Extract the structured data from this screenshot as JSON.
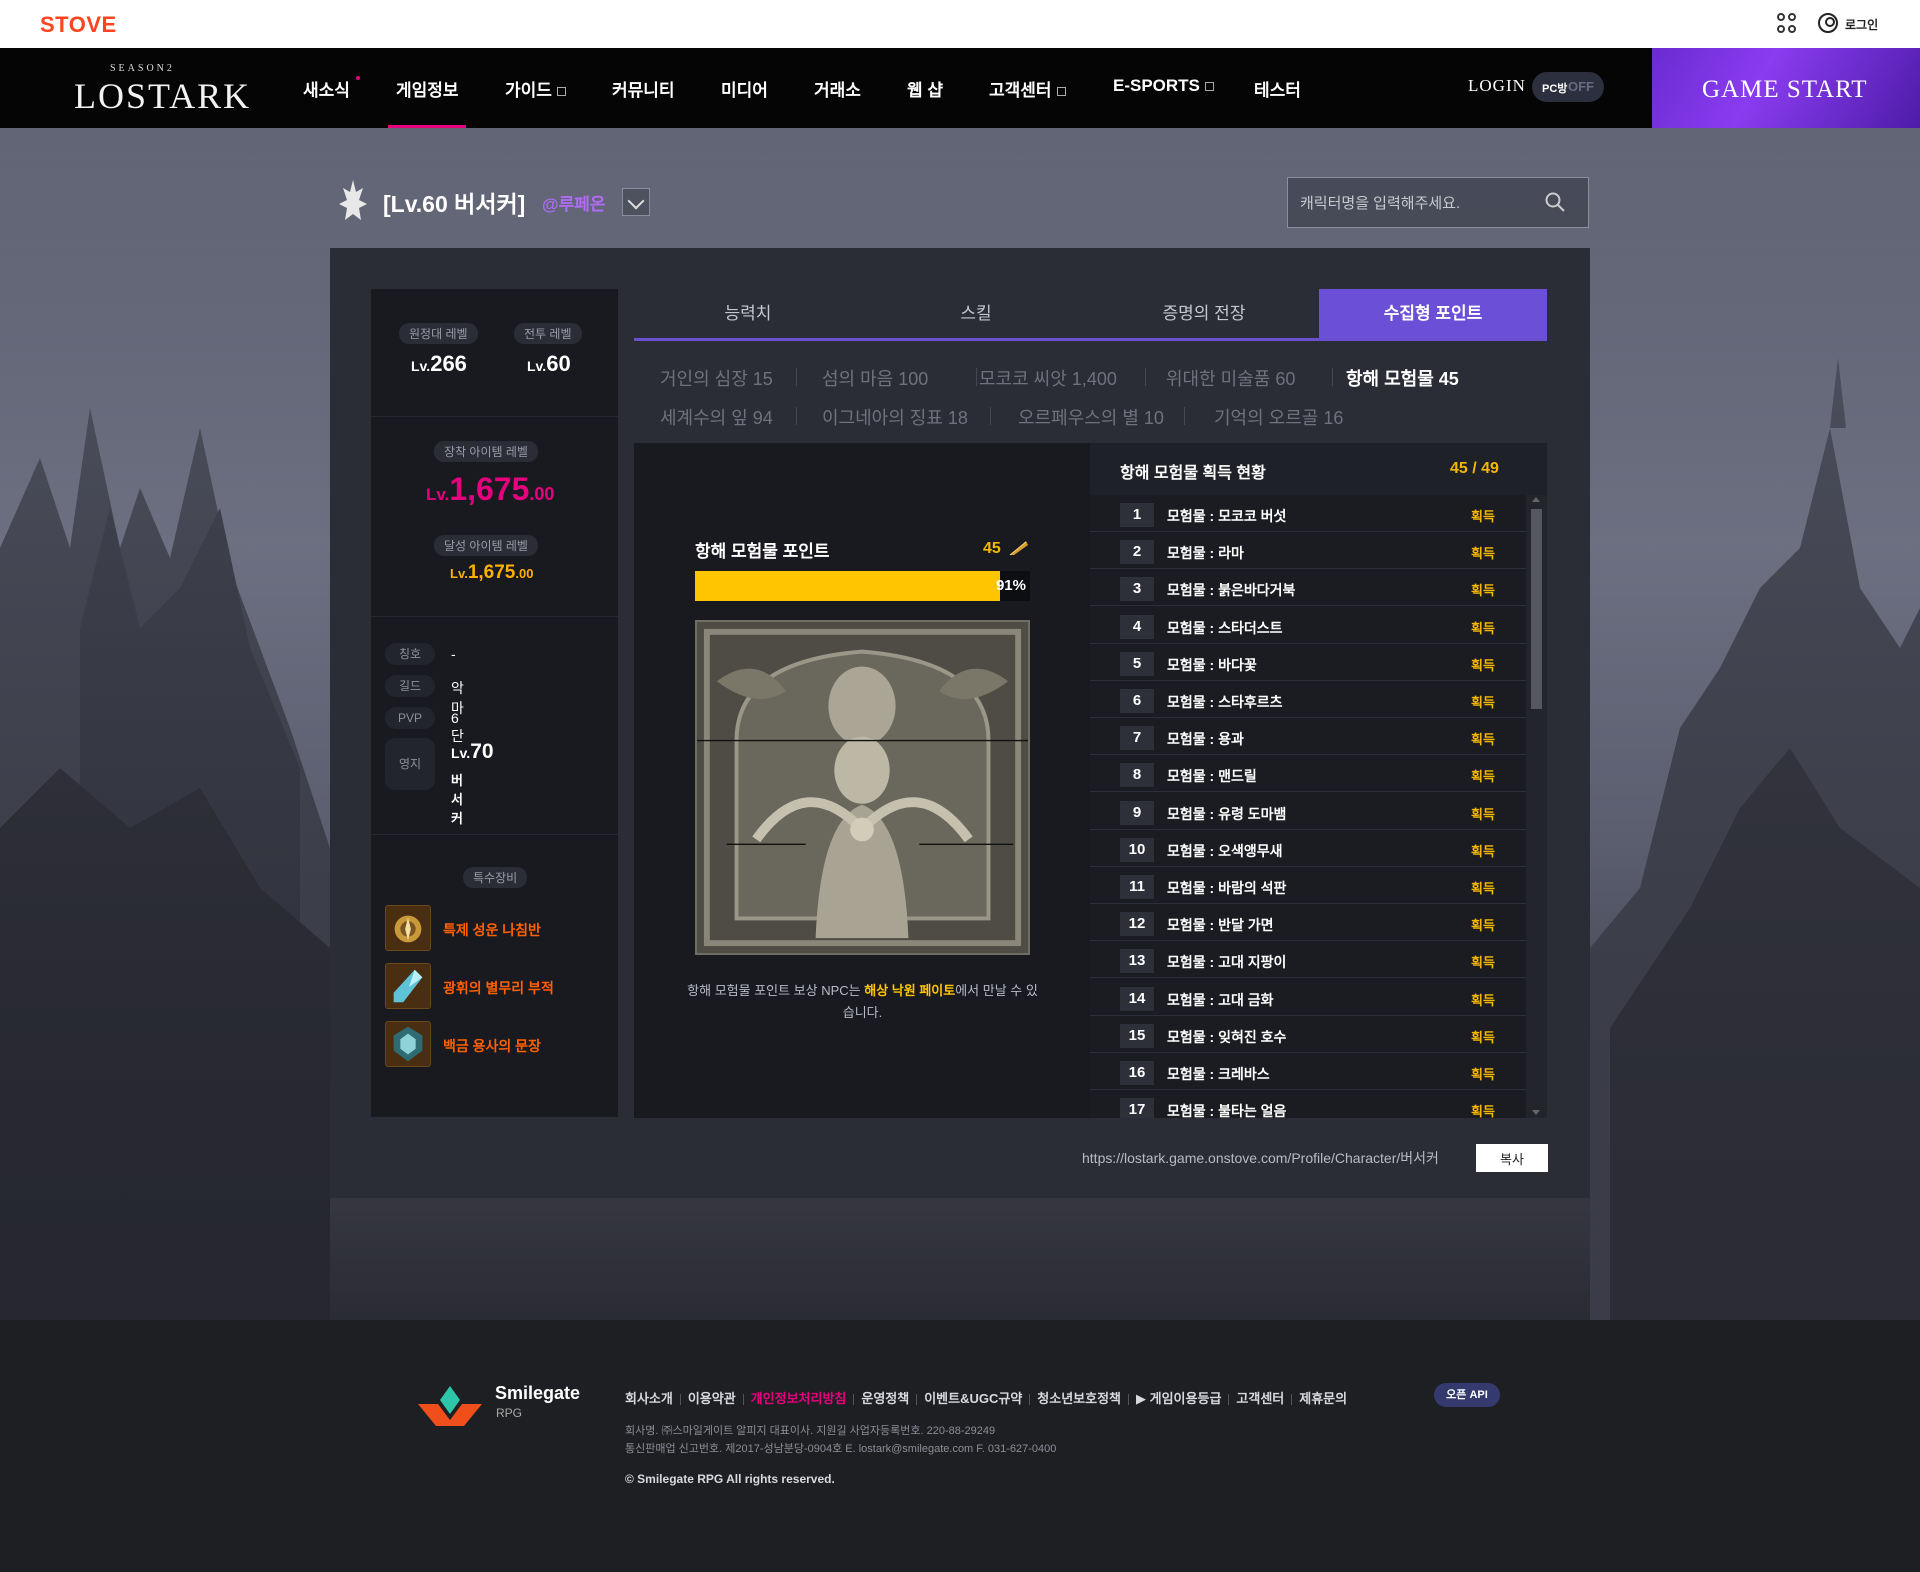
{
  "stove": {
    "logo": "STOVE",
    "login": "로그인"
  },
  "nav": {
    "logo_season": "SEASON2",
    "logo_name": "LOSTARK",
    "items": [
      "새소식",
      "게임정보",
      "가이드",
      "커뮤니티",
      "미디어",
      "거래소",
      "웹 샵",
      "고객센터",
      "E-SPORTS",
      "테스터"
    ],
    "login": "LOGIN",
    "pc_label": "PC방",
    "pc_state": "OFF",
    "game_start": "GAME START"
  },
  "character": {
    "title": "[Lv.60 버서커]",
    "server": "@루페온",
    "search_placeholder": "캐릭터명을 입력해주세요."
  },
  "left": {
    "expedition_label": "원정대 레벨",
    "expedition_prefix": "Lv.",
    "expedition_value": "266",
    "battle_label": "전투 레벨",
    "battle_prefix": "Lv.",
    "battle_value": "60",
    "equip_label": "장착 아이템 레벨",
    "equip_prefix": "Lv.",
    "equip_main": "1,675",
    "equip_dec": ".00",
    "achieved_label": "달성 아이템 레벨",
    "achieved_prefix": "Lv.",
    "achieved_main": "1,675",
    "achieved_dec": ".00",
    "info": [
      {
        "key": "칭호",
        "value": "-"
      },
      {
        "key": "길드",
        "value": "악마"
      },
      {
        "key": "PVP",
        "value": "6단"
      }
    ],
    "territory_key": "영지",
    "territory_prefix": "Lv.",
    "territory_level": "70",
    "territory_name": "버서커",
    "special_label": "특수장비",
    "special_items": [
      "특제 성운 나침반",
      "광휘의 별무리 부적",
      "백금 용사의 문장"
    ]
  },
  "tabs": [
    "능력치",
    "스킬",
    "증명의 전장",
    "수집형 포인트"
  ],
  "subtabs_row1": [
    "거인의 심장 15",
    "섬의 마음 100",
    "모코코 씨앗 1,400",
    "위대한 미술품 60",
    "항해 모험물 45"
  ],
  "subtabs_row2": [
    "세계수의 잎 94",
    "이그네아의 징표 18",
    "오르페우스의 별 10",
    "기억의 오르골 16"
  ],
  "collection": {
    "points_label": "항해 모험물 포인트",
    "points_value": "45",
    "progress_percent": 91,
    "progress_text": "91%",
    "npc_text_before": "항해 모험물 포인트 보상 NPC는 ",
    "npc_name": "해상 낙원 페이토",
    "npc_text_after": "에서 만날 수 있습니다.",
    "list_title": "항해 모험물 획득 현황",
    "list_count": "45 / 49",
    "items": [
      {
        "num": "1",
        "name": "모험물 : 모코코 버섯",
        "status": "획득"
      },
      {
        "num": "2",
        "name": "모험물 : 라마",
        "status": "획득"
      },
      {
        "num": "3",
        "name": "모험물 : 붉은바다거북",
        "status": "획득"
      },
      {
        "num": "4",
        "name": "모험물 : 스타더스트",
        "status": "획득"
      },
      {
        "num": "5",
        "name": "모험물 : 바다꽃",
        "status": "획득"
      },
      {
        "num": "6",
        "name": "모험물 : 스타후르츠",
        "status": "획득"
      },
      {
        "num": "7",
        "name": "모험물 : 용과",
        "status": "획득"
      },
      {
        "num": "8",
        "name": "모험물 : 맨드릴",
        "status": "획득"
      },
      {
        "num": "9",
        "name": "모험물 : 유령 도마뱀",
        "status": "획득"
      },
      {
        "num": "10",
        "name": "모험물 : 오색앵무새",
        "status": "획득"
      },
      {
        "num": "11",
        "name": "모험물 : 바람의 석판",
        "status": "획득"
      },
      {
        "num": "12",
        "name": "모험물 : 반달 가면",
        "status": "획득"
      },
      {
        "num": "13",
        "name": "모험물 : 고대 지팡이",
        "status": "획득"
      },
      {
        "num": "14",
        "name": "모험물 : 고대 금화",
        "status": "획득"
      },
      {
        "num": "15",
        "name": "모험물 : 잊혀진 호수",
        "status": "획득"
      },
      {
        "num": "16",
        "name": "모험물 : 크레바스",
        "status": "획득"
      },
      {
        "num": "17",
        "name": "모험물 : 불타는 얼음",
        "status": "획득"
      }
    ]
  },
  "profile_url": "https://lostark.game.onstove.com/Profile/Character/버서커",
  "copy_label": "복사",
  "footer": {
    "brand": "Smilegate",
    "brand_sub": "RPG",
    "links": [
      "회사소개",
      "이용약관",
      "개인정보처리방침",
      "운영정책",
      "이벤트&UGC규약",
      "청소년보호정책",
      "▶ 게임이용등급",
      "고객센터",
      "제휴문의"
    ],
    "open_api": "오픈 API",
    "line1": "회사명. ㈜스마일게이트 알피지    대표이사. 지원길    사업자등록번호. 220-88-29249",
    "line2": "통신판매업 신고번호. 제2017-성남분당-0904호    E. lostark@smilegate.com    F. 031-627-0400",
    "copyright": "© Smilegate RPG All rights reserved."
  },
  "colors": {
    "accent_purple": "#6b4fd6",
    "level_pink": "#e6007e",
    "gold": "#ffc600",
    "relic_orange": "#ff6000"
  }
}
